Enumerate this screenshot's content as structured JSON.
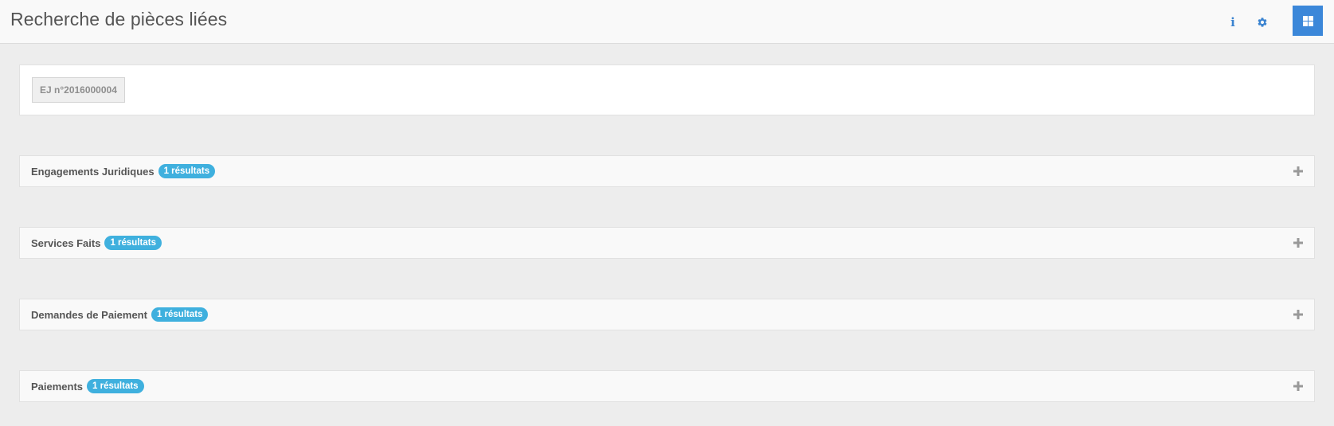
{
  "header": {
    "title": "Recherche de pièces liées",
    "icons": [
      "info-icon",
      "gear-icon",
      "grid-icon"
    ]
  },
  "filter": {
    "tag_label": "EJ n°2016000004"
  },
  "sections": [
    {
      "title": "Engagements Juridiques",
      "badge": "1 résultats"
    },
    {
      "title": "Services Faits",
      "badge": "1 résultats"
    },
    {
      "title": "Demandes de Paiement",
      "badge": "1 résultats"
    },
    {
      "title": "Paiements",
      "badge": "1 résultats"
    }
  ],
  "colors": {
    "accent": "#3b87d9",
    "badge": "#3fb0de",
    "background": "#ededed"
  }
}
